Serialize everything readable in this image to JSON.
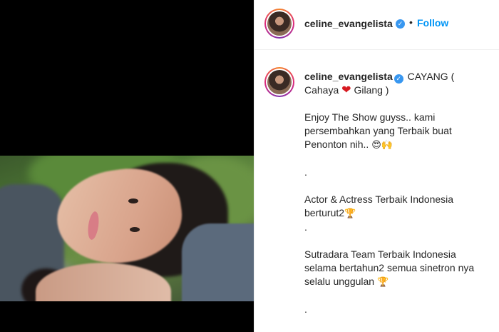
{
  "post": {
    "author": {
      "username": "celine_evangelista",
      "verified": true,
      "verified_icon": "verified-badge-icon"
    },
    "header": {
      "separator": "•",
      "follow_label": "Follow"
    },
    "caption": {
      "title_start": "CAYANG (",
      "title_line2_a": "Cahaya",
      "heart": "❤",
      "title_line2_b": "Gilang )",
      "para1_line1": "Enjoy The Show guyss.. kami",
      "para1_line2": "persembahkan yang Terbaik buat",
      "para1_line3": "Penonton nih..",
      "para1_emoji": "😍🙌",
      "dot1": ".",
      "para2_line1": "Actor & Actress Terbaik Indonesia",
      "para2_line2": "berturut2",
      "trophy": "🏆",
      "dot2": ".",
      "para3_line1": "Sutradara Team Terbaik Indonesia",
      "para3_line2": "selama bertahun2 semua sinetron nya",
      "para3_line3": "selalu unggulan",
      "dot3": "."
    }
  },
  "colors": {
    "accent": "#0095f6",
    "verified": "#3897f0",
    "text": "#262626",
    "heart": "#d71920",
    "media_bg": "#000000"
  }
}
